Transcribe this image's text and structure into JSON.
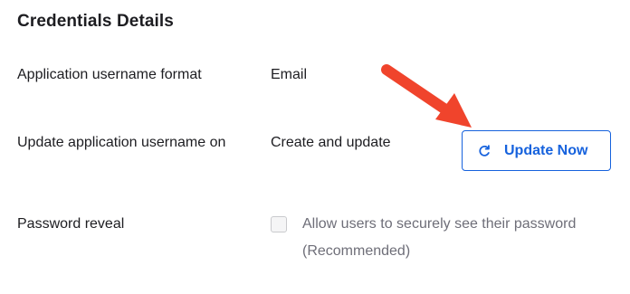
{
  "section": {
    "title": "Credentials Details"
  },
  "rows": [
    {
      "label": "Application username format",
      "value": "Email"
    },
    {
      "label": "Update application username on",
      "value": "Create and update"
    },
    {
      "label": "Password reveal"
    }
  ],
  "update_button": {
    "label": "Update Now",
    "icon": "refresh-icon"
  },
  "password_reveal": {
    "checkbox_label": "Allow users to securely see their password (Recommended)",
    "checked": false
  },
  "annotation": {
    "icon": "red-arrow-icon",
    "color": "#f0442c"
  },
  "colors": {
    "accent": "#1662dd",
    "text": "#1d1d21",
    "muted_text": "#6e6e78"
  }
}
